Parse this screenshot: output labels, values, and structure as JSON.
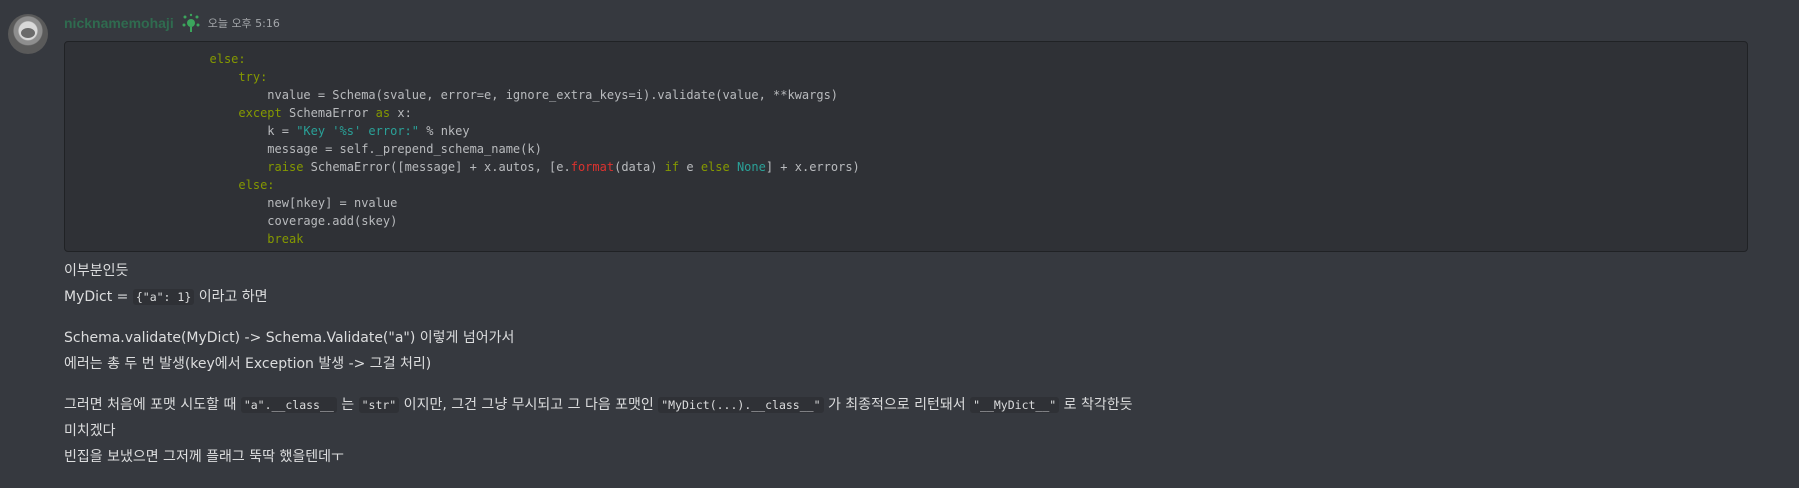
{
  "message": {
    "username": "nicknamemohaji",
    "timestamp": "오늘 오후 5:16",
    "avatar": "seal-avatar",
    "code_lines": [
      [
        {
          "t": "                    "
        },
        {
          "t": "else:",
          "c": "kw"
        }
      ],
      [
        {
          "t": "                        "
        },
        {
          "t": "try:",
          "c": "kw"
        }
      ],
      [
        {
          "t": "                            nvalue = Schema(svalue, error=e, ignore_extra_keys=i).validate(value, **kwargs)"
        }
      ],
      [
        {
          "t": "                        "
        },
        {
          "t": "except",
          "c": "kw"
        },
        {
          "t": " SchemaError "
        },
        {
          "t": "as",
          "c": "kw"
        },
        {
          "t": " x:"
        }
      ],
      [
        {
          "t": "                            k = "
        },
        {
          "t": "\"Key '%s' error:\"",
          "c": "str"
        },
        {
          "t": " % nkey"
        }
      ],
      [
        {
          "t": "                            message = self._prepend_schema_name(k)"
        }
      ],
      [
        {
          "t": "                            "
        },
        {
          "t": "raise",
          "c": "kw"
        },
        {
          "t": " SchemaError([message] + x.autos, [e."
        },
        {
          "t": "format",
          "c": "fn"
        },
        {
          "t": "(data) "
        },
        {
          "t": "if",
          "c": "kw"
        },
        {
          "t": " e "
        },
        {
          "t": "else",
          "c": "kw"
        },
        {
          "t": " "
        },
        {
          "t": "None",
          "c": "str"
        },
        {
          "t": "] + x.errors)"
        }
      ],
      [
        {
          "t": "                        "
        },
        {
          "t": "else:",
          "c": "kw"
        }
      ],
      [
        {
          "t": "                            new[nkey] = nvalue"
        }
      ],
      [
        {
          "t": "                            coverage.add(skey)"
        }
      ],
      [
        {
          "t": "                            "
        },
        {
          "t": "break",
          "c": "kw"
        }
      ]
    ],
    "line1": "이부분인듯",
    "line2_a": "MyDict = ",
    "line2_code": "{\"a\": 1}",
    "line2_b": " 이라고 하면",
    "line3": "Schema.validate(MyDict) -> Schema.Validate(\"a\") 이렇게 넘어가서",
    "line4": "에러는 총 두 번 발생(key에서 Exception 발생 -> 그걸 처리)",
    "line5_a": "그러면 처음에 포맷 시도할 때 ",
    "line5_code1": "\"a\".__class__",
    "line5_b": " 는 ",
    "line5_code2": "\"str\"",
    "line5_c": " 이지만, 그건 그냥 무시되고 그 다음 포맷인 ",
    "line5_code3": "\"MyDict(...).__class__\"",
    "line5_d": " 가 최종적으로 리턴돼서 ",
    "line5_code4": "\"__MyDict__\"",
    "line5_e": " 로 착각한듯",
    "line6": "미치겠다",
    "line7": "빈집을 보냈으면 그저께 플래그 뚝딱 했을텐데ㅜ"
  }
}
